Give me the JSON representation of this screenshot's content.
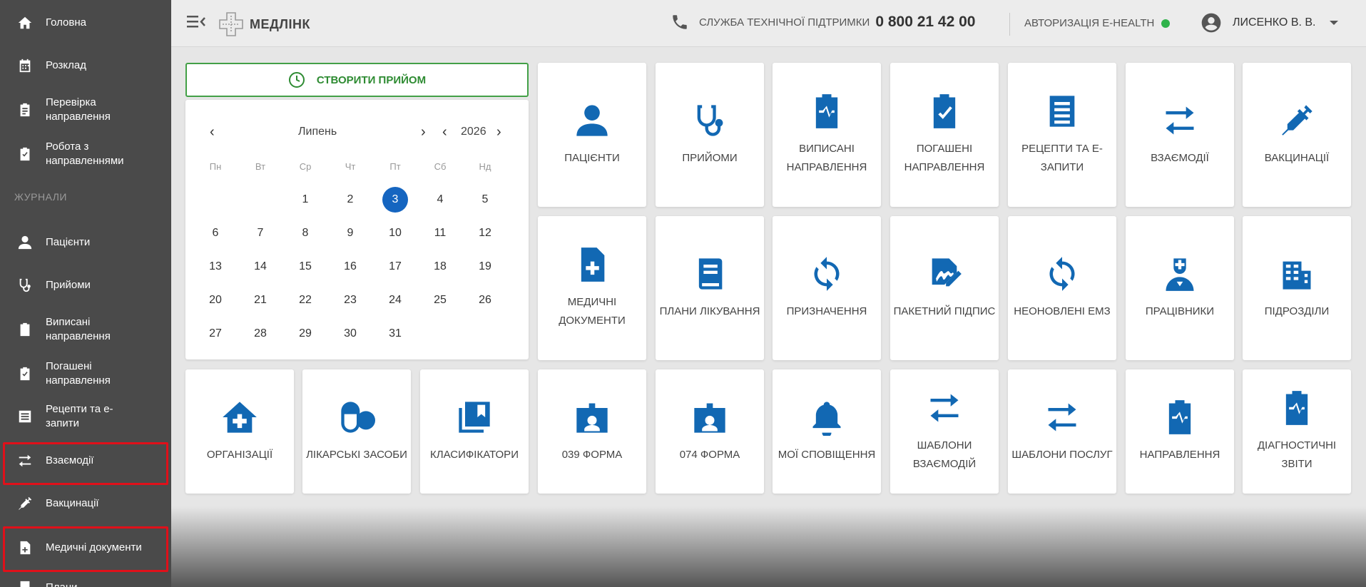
{
  "sidebar": {
    "items": [
      {
        "label": "Головна",
        "icon": "home-icon"
      },
      {
        "label": "Розклад",
        "icon": "calendar-icon"
      },
      {
        "label": "Перевірка направлення",
        "icon": "clipboard-list-icon"
      },
      {
        "label": "Робота з направленнями",
        "icon": "clipboard-check-icon"
      }
    ],
    "section_label": "ЖУРНАЛИ",
    "journal_items": [
      {
        "label": "Пацієнти",
        "icon": "user-icon"
      },
      {
        "label": "Прийоми",
        "icon": "stethoscope-icon"
      },
      {
        "label": "Виписані направлення",
        "icon": "clipboard-icon"
      },
      {
        "label": "Погашені направлення",
        "icon": "clipboard-check-icon"
      },
      {
        "label": "Рецепти та е-запити",
        "icon": "receipt-icon"
      },
      {
        "label": "Взаємодії",
        "icon": "exchange-icon"
      },
      {
        "label": "Вакцинації",
        "icon": "syringe-icon"
      },
      {
        "label": "Медичні документи",
        "icon": "medical-file-icon"
      },
      {
        "label": "Плани",
        "icon": "book-icon"
      }
    ]
  },
  "header": {
    "logo_text": "МЕДЛІНК",
    "support_label": "СЛУЖБА ТЕХНІЧНОЇ ПІДТРИМКИ",
    "support_phone": "0 800 21 42 00",
    "ehealth_label": "АВТОРИЗАЦІЯ E-HEALTH",
    "ehealth_status_color": "#2fb24a",
    "user_name": "ЛИСЕНКО В. В."
  },
  "create_button": {
    "label": "СТВОРИТИ ПРИЙОМ"
  },
  "calendar": {
    "month": "Липень",
    "year": "2026",
    "weekdays": [
      "Пн",
      "Вт",
      "Ср",
      "Чт",
      "Пт",
      "Сб",
      "Нд"
    ],
    "selected_day": "3",
    "first_weekday_index": 2,
    "days_in_month": 31
  },
  "tiles": [
    {
      "label": "ПАЦІЄНТИ",
      "icon": "user-icon"
    },
    {
      "label": "ПРИЙОМИ",
      "icon": "stethoscope-icon"
    },
    {
      "label": "ВИПИСАНІ НАПРАВЛЕННЯ",
      "icon": "clipboard-pulse-icon"
    },
    {
      "label": "ПОГАШЕНІ НАПРАВЛЕННЯ",
      "icon": "clipboard-check-icon"
    },
    {
      "label": "РЕЦЕПТИ ТА Е-ЗАПИТИ",
      "icon": "receipt-icon"
    },
    {
      "label": "ВЗАЄМОДІЇ",
      "icon": "exchange-icon"
    },
    {
      "label": "ВАКЦИНАЦІЇ",
      "icon": "syringe-icon"
    },
    {
      "label": "МЕДИЧНІ ДОКУМЕНТИ",
      "icon": "medical-file-icon"
    },
    {
      "label": "ПЛАНИ ЛІКУВАННЯ",
      "icon": "book-icon"
    },
    {
      "label": "ПРИЗНАЧЕННЯ",
      "icon": "sync-icon"
    },
    {
      "label": "ПАКЕТНИЙ ПІДПИС",
      "icon": "signature-icon"
    },
    {
      "label": "НЕОНОВЛЕНІ ЕМЗ",
      "icon": "sync-icon"
    },
    {
      "label": "ПРАЦІВНИКИ",
      "icon": "doctor-icon"
    },
    {
      "label": "ПІДРОЗДІЛИ",
      "icon": "building-icon"
    },
    {
      "label": "ОРГАНІЗАЦІЇ",
      "icon": "clinic-icon"
    },
    {
      "label": "ЛІКАРСЬКІ ЗАСОБИ",
      "icon": "pills-icon"
    },
    {
      "label": "КЛАСИФІКАТОРИ",
      "icon": "bookmark-stack-icon"
    },
    {
      "label": "039 ФОРМА",
      "icon": "id-badge-icon"
    },
    {
      "label": "074 ФОРМА",
      "icon": "id-badge-icon"
    },
    {
      "label": "МОЇ СПОВІЩЕННЯ",
      "icon": "bell-icon"
    },
    {
      "label": "ШАБЛОНИ ВЗАЄМОДІЙ",
      "icon": "exchange-icon"
    },
    {
      "label": "ШАБЛОНИ ПОСЛУГ",
      "icon": "exchange-icon"
    },
    {
      "label": "НАПРАВЛЕННЯ",
      "icon": "clipboard-pulse-icon"
    },
    {
      "label": "ДІАГНОСТИЧНІ ЗВІТИ",
      "icon": "clipboard-pulse-icon"
    }
  ],
  "highlighted_items": [
    "Взаємодії",
    "Медичні документи"
  ],
  "colors": {
    "accent_blue": "#1268b3",
    "accent_green": "#43a047",
    "highlight_red": "#e0101a",
    "sidebar_bg": "#4a4a4a"
  }
}
